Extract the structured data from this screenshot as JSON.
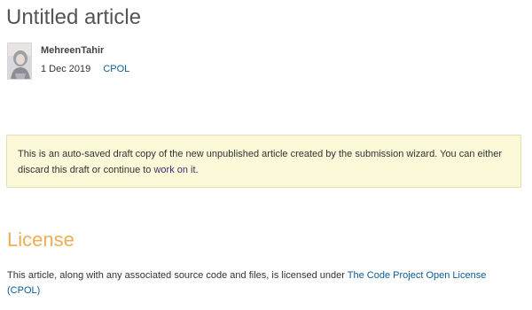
{
  "article": {
    "title": "Untitled article"
  },
  "author": {
    "name": "MehreenTahir",
    "date": "1 Dec 2019",
    "license_short": "CPOL",
    "avatar_icon": "user-avatar"
  },
  "notice": {
    "text_before": "This is an auto-saved draft copy of the new unpublished article created by the submission wizard. You can either discard this draft or continue to ",
    "link_text": "work on it",
    "text_after": "."
  },
  "license_section": {
    "heading": "License",
    "text_before": "This article, along with any associated source code and files, is licensed under ",
    "link_text": "The Code Project Open License (CPOL)"
  },
  "colors": {
    "heading_accent": "#efad54",
    "link": "#0b5b96",
    "notice_background": "#fbf9d8"
  }
}
